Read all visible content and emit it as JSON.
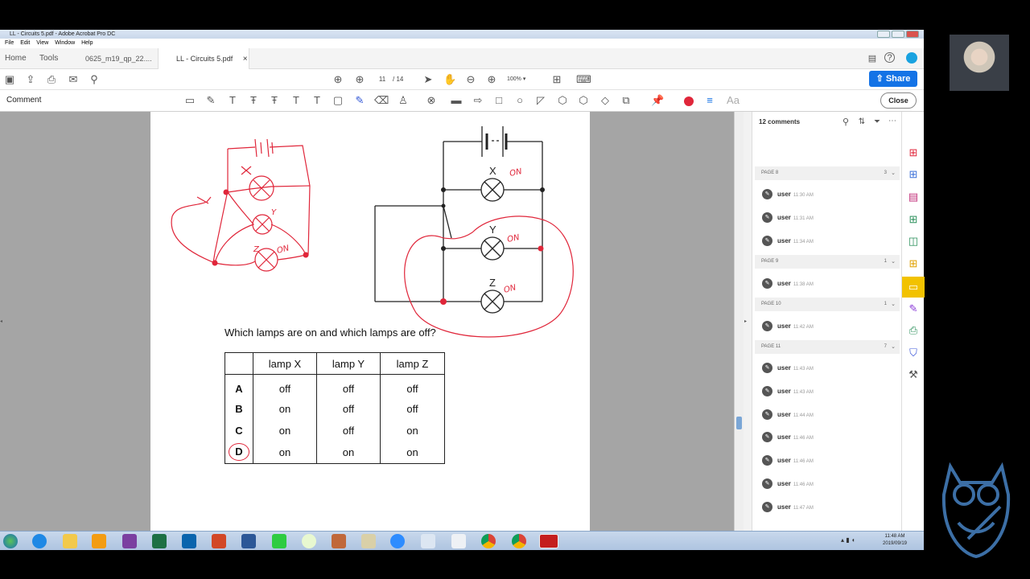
{
  "window": {
    "title": "LL - Circuits 5.pdf - Adobe Acrobat Pro DC"
  },
  "menu": [
    "File",
    "Edit",
    "View",
    "Window",
    "Help"
  ],
  "tabs": {
    "home": "Home",
    "tools": "Tools",
    "doc1": "0625_m19_qp_22....",
    "doc2": "LL - Circuits 5.pdf",
    "close_glyph": "×"
  },
  "nav": {
    "page_current": "11",
    "page_total": "/ 14",
    "zoom": "100%"
  },
  "share_label": "Share",
  "comment_toolbar": {
    "label": "Comment",
    "close_label": "Close"
  },
  "doc": {
    "labels": {
      "x": "X",
      "y": "Y",
      "z": "Z"
    },
    "question": "Which lamps are on and which lamps are off?",
    "table": {
      "headers": [
        "",
        "lamp X",
        "lamp Y",
        "lamp Z"
      ],
      "rows": [
        [
          "A",
          "off",
          "off",
          "off"
        ],
        [
          "B",
          "on",
          "off",
          "off"
        ],
        [
          "C",
          "on",
          "off",
          "on"
        ],
        [
          "D",
          "on",
          "on",
          "on"
        ]
      ]
    },
    "handwriting": {
      "on1": "ON",
      "on2": "ON",
      "on3": "ON",
      "on4": "ON",
      "y": "Y",
      "z": "Z"
    }
  },
  "comments": {
    "count_label": "12 comments",
    "groups": [
      {
        "page": "PAGE 8",
        "count": "3",
        "items": [
          {
            "user": "user",
            "time": "11:30 AM"
          },
          {
            "user": "user",
            "time": "11:31 AM"
          },
          {
            "user": "user",
            "time": "11:34 AM"
          }
        ]
      },
      {
        "page": "PAGE 9",
        "count": "1",
        "items": [
          {
            "user": "user",
            "time": "11:38 AM"
          }
        ]
      },
      {
        "page": "PAGE 10",
        "count": "1",
        "items": [
          {
            "user": "user",
            "time": "11:42 AM"
          }
        ]
      },
      {
        "page": "PAGE 11",
        "count": "7",
        "items": [
          {
            "user": "user",
            "time": "11:43 AM"
          },
          {
            "user": "user",
            "time": "11:43 AM"
          },
          {
            "user": "user",
            "time": "11:44 AM"
          },
          {
            "user": "user",
            "time": "11:46 AM"
          },
          {
            "user": "user",
            "time": "11:46 AM"
          },
          {
            "user": "user",
            "time": "11:46 AM"
          },
          {
            "user": "user",
            "time": "11:47 AM"
          }
        ]
      }
    ]
  },
  "taskbar": {
    "time": "11:48 AM",
    "date": "2019/09/19"
  },
  "colors": {
    "accent": "#1473e6",
    "ink": "#e0263a",
    "comment_active": "#f2c200"
  }
}
